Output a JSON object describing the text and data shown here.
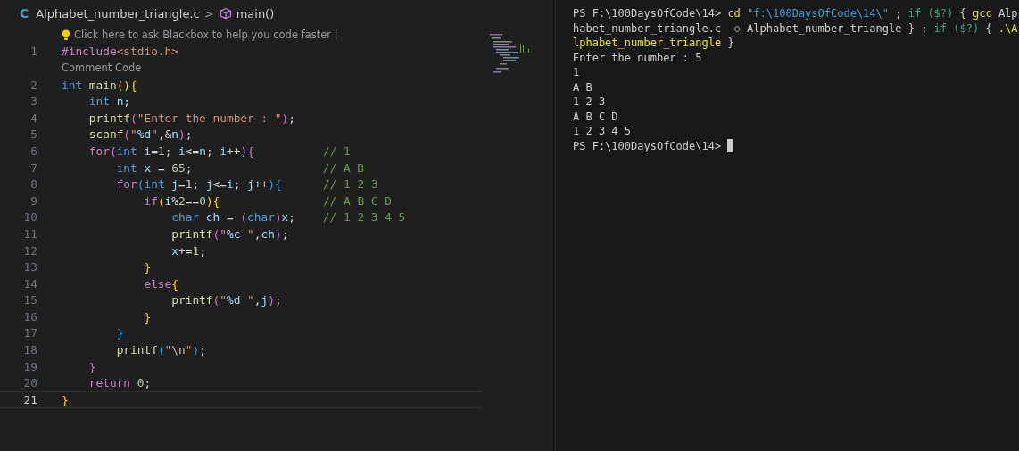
{
  "breadcrumb": {
    "file_icon_letter": "C",
    "file": "Alphabet_number_triangle.c",
    "separator": ">",
    "symbol": "main()"
  },
  "editor": {
    "lines": [
      {
        "kind": "hint",
        "text": "Click here to ask Blackbox to help you code faster |"
      },
      {
        "kind": "code",
        "number": "1",
        "current": false,
        "tokens": [
          {
            "kind": "ctrl",
            "text": "#include"
          },
          {
            "kind": "str",
            "text": "<stdio.h>"
          }
        ]
      },
      {
        "kind": "lens",
        "text": "Comment Code"
      },
      {
        "kind": "code",
        "number": "2",
        "current": false,
        "tokens": [
          {
            "kind": "type",
            "text": "int"
          },
          {
            "kind": "fn",
            "text": " main"
          },
          {
            "kind": "b1",
            "text": "(){"
          }
        ]
      },
      {
        "kind": "code",
        "number": "3",
        "current": false,
        "tokens": [
          {
            "kind": "type",
            "text": "    int"
          },
          {
            "kind": "var",
            "text": " n"
          },
          {
            "kind": "plain",
            "text": ";"
          }
        ]
      },
      {
        "kind": "code",
        "number": "4",
        "current": false,
        "tokens": [
          {
            "kind": "fn",
            "text": "    printf"
          },
          {
            "kind": "b2",
            "text": "("
          },
          {
            "kind": "str",
            "text": "\"Enter the number : \""
          },
          {
            "kind": "b2",
            "text": ")"
          },
          {
            "kind": "plain",
            "text": ";"
          }
        ]
      },
      {
        "kind": "code",
        "number": "5",
        "current": false,
        "tokens": [
          {
            "kind": "fn",
            "text": "    scanf"
          },
          {
            "kind": "b2",
            "text": "("
          },
          {
            "kind": "str",
            "text": "\""
          },
          {
            "kind": "fmt",
            "text": "%d"
          },
          {
            "kind": "str",
            "text": "\""
          },
          {
            "kind": "plain",
            "text": ",&"
          },
          {
            "kind": "var",
            "text": "n"
          },
          {
            "kind": "b2",
            "text": ")"
          },
          {
            "kind": "plain",
            "text": ";"
          }
        ]
      },
      {
        "kind": "code",
        "number": "6",
        "current": false,
        "tokens": [
          {
            "kind": "ctrl",
            "text": "    for"
          },
          {
            "kind": "b2",
            "text": "("
          },
          {
            "kind": "type",
            "text": "int"
          },
          {
            "kind": "var",
            "text": " i"
          },
          {
            "kind": "plain",
            "text": "="
          },
          {
            "kind": "num",
            "text": "1"
          },
          {
            "kind": "plain",
            "text": ";"
          },
          {
            "kind": "var",
            "text": " i"
          },
          {
            "kind": "plain",
            "text": "<="
          },
          {
            "kind": "var",
            "text": "n"
          },
          {
            "kind": "plain",
            "text": ";"
          },
          {
            "kind": "var",
            "text": " i"
          },
          {
            "kind": "plain",
            "text": "++"
          },
          {
            "kind": "b2",
            "text": "){"
          },
          {
            "kind": "cmt",
            "text": "          // 1"
          }
        ]
      },
      {
        "kind": "code",
        "number": "7",
        "current": false,
        "tokens": [
          {
            "kind": "type",
            "text": "        int"
          },
          {
            "kind": "var",
            "text": " x"
          },
          {
            "kind": "plain",
            "text": " = "
          },
          {
            "kind": "num",
            "text": "65"
          },
          {
            "kind": "plain",
            "text": ";"
          },
          {
            "kind": "cmt",
            "text": "                   // A B"
          }
        ]
      },
      {
        "kind": "code",
        "number": "8",
        "current": false,
        "tokens": [
          {
            "kind": "ctrl",
            "text": "        for"
          },
          {
            "kind": "b3",
            "text": "("
          },
          {
            "kind": "type",
            "text": "int"
          },
          {
            "kind": "var",
            "text": " j"
          },
          {
            "kind": "plain",
            "text": "="
          },
          {
            "kind": "num",
            "text": "1"
          },
          {
            "kind": "plain",
            "text": ";"
          },
          {
            "kind": "var",
            "text": " j"
          },
          {
            "kind": "plain",
            "text": "<="
          },
          {
            "kind": "var",
            "text": "i"
          },
          {
            "kind": "plain",
            "text": ";"
          },
          {
            "kind": "var",
            "text": " j"
          },
          {
            "kind": "plain",
            "text": "++"
          },
          {
            "kind": "b3",
            "text": "){"
          },
          {
            "kind": "cmt",
            "text": "      // 1 2 3"
          }
        ]
      },
      {
        "kind": "code",
        "number": "9",
        "current": false,
        "tokens": [
          {
            "kind": "ctrl",
            "text": "            if"
          },
          {
            "kind": "b1",
            "text": "("
          },
          {
            "kind": "var",
            "text": "i"
          },
          {
            "kind": "plain",
            "text": "%"
          },
          {
            "kind": "num",
            "text": "2"
          },
          {
            "kind": "plain",
            "text": "=="
          },
          {
            "kind": "num",
            "text": "0"
          },
          {
            "kind": "b1",
            "text": "){"
          },
          {
            "kind": "cmt",
            "text": "               // A B C D"
          }
        ]
      },
      {
        "kind": "code",
        "number": "10",
        "current": false,
        "tokens": [
          {
            "kind": "type",
            "text": "                char"
          },
          {
            "kind": "var",
            "text": " ch"
          },
          {
            "kind": "plain",
            "text": " = "
          },
          {
            "kind": "b2",
            "text": "("
          },
          {
            "kind": "type",
            "text": "char"
          },
          {
            "kind": "b2",
            "text": ")"
          },
          {
            "kind": "var",
            "text": "x"
          },
          {
            "kind": "plain",
            "text": ";"
          },
          {
            "kind": "cmt",
            "text": "    // 1 2 3 4 5"
          }
        ]
      },
      {
        "kind": "code",
        "number": "11",
        "current": false,
        "tokens": [
          {
            "kind": "fn",
            "text": "                printf"
          },
          {
            "kind": "b2",
            "text": "("
          },
          {
            "kind": "str",
            "text": "\""
          },
          {
            "kind": "fmt",
            "text": "%c"
          },
          {
            "kind": "str",
            "text": " \""
          },
          {
            "kind": "plain",
            "text": ","
          },
          {
            "kind": "var",
            "text": "ch"
          },
          {
            "kind": "b2",
            "text": ")"
          },
          {
            "kind": "plain",
            "text": ";"
          }
        ]
      },
      {
        "kind": "code",
        "number": "12",
        "current": false,
        "tokens": [
          {
            "kind": "var",
            "text": "                x"
          },
          {
            "kind": "plain",
            "text": "+="
          },
          {
            "kind": "num",
            "text": "1"
          },
          {
            "kind": "plain",
            "text": ";"
          }
        ]
      },
      {
        "kind": "code",
        "number": "13",
        "current": false,
        "tokens": [
          {
            "kind": "b1",
            "text": "            }"
          }
        ]
      },
      {
        "kind": "code",
        "number": "14",
        "current": false,
        "tokens": [
          {
            "kind": "ctrl",
            "text": "            else"
          },
          {
            "kind": "b1",
            "text": "{"
          }
        ]
      },
      {
        "kind": "code",
        "number": "15",
        "current": false,
        "tokens": [
          {
            "kind": "fn",
            "text": "                printf"
          },
          {
            "kind": "b2",
            "text": "("
          },
          {
            "kind": "str",
            "text": "\""
          },
          {
            "kind": "fmt",
            "text": "%d"
          },
          {
            "kind": "str",
            "text": " \""
          },
          {
            "kind": "plain",
            "text": ","
          },
          {
            "kind": "var",
            "text": "j"
          },
          {
            "kind": "b2",
            "text": ")"
          },
          {
            "kind": "plain",
            "text": ";"
          }
        ]
      },
      {
        "kind": "code",
        "number": "16",
        "current": false,
        "tokens": [
          {
            "kind": "b1",
            "text": "            }"
          }
        ]
      },
      {
        "kind": "code",
        "number": "17",
        "current": false,
        "tokens": [
          {
            "kind": "b3",
            "text": "        }"
          }
        ]
      },
      {
        "kind": "code",
        "number": "18",
        "current": false,
        "tokens": [
          {
            "kind": "fn",
            "text": "        printf"
          },
          {
            "kind": "b3",
            "text": "("
          },
          {
            "kind": "str",
            "text": "\""
          },
          {
            "kind": "esc",
            "text": "\\n"
          },
          {
            "kind": "str",
            "text": "\""
          },
          {
            "kind": "b3",
            "text": ")"
          },
          {
            "kind": "plain",
            "text": ";"
          }
        ]
      },
      {
        "kind": "code",
        "number": "19",
        "current": false,
        "tokens": [
          {
            "kind": "b2",
            "text": "    }"
          }
        ]
      },
      {
        "kind": "code",
        "number": "20",
        "current": false,
        "tokens": [
          {
            "kind": "ctrl",
            "text": "    return"
          },
          {
            "kind": "num",
            "text": " 0"
          },
          {
            "kind": "plain",
            "text": ";"
          }
        ]
      },
      {
        "kind": "code",
        "number": "21",
        "current": true,
        "tokens": [
          {
            "kind": "b1",
            "text": "}"
          }
        ]
      }
    ]
  },
  "terminal": {
    "lines": [
      [
        {
          "kind": "plain",
          "text": "PS F:\\100DaysOfCode\\14> "
        },
        {
          "kind": "cmd",
          "text": "cd"
        },
        {
          "kind": "str",
          "text": " \"f:\\100DaysOfCode\\14\\\""
        },
        {
          "kind": "plain",
          "text": " ; "
        },
        {
          "kind": "kw",
          "text": "if ($?)"
        },
        {
          "kind": "plain",
          "text": " { "
        },
        {
          "kind": "cmd",
          "text": "gcc"
        },
        {
          "kind": "plain",
          "text": " Alp"
        }
      ],
      [
        {
          "kind": "plain",
          "text": "habet_number_triangle.c "
        },
        {
          "kind": "flag",
          "text": "-o"
        },
        {
          "kind": "plain",
          "text": " Alphabet_number_triangle } ; "
        },
        {
          "kind": "kw",
          "text": "if ($?)"
        },
        {
          "kind": "plain",
          "text": " { "
        },
        {
          "kind": "cmd",
          "text": ".\\A"
        }
      ],
      [
        {
          "kind": "cmd",
          "text": "lphabet_number_triangle"
        },
        {
          "kind": "plain",
          "text": " }"
        }
      ],
      [
        {
          "kind": "plain",
          "text": "Enter the number : 5"
        }
      ],
      [
        {
          "kind": "plain",
          "text": "1"
        }
      ],
      [
        {
          "kind": "plain",
          "text": "A B"
        }
      ],
      [
        {
          "kind": "plain",
          "text": "1 2 3"
        }
      ],
      [
        {
          "kind": "plain",
          "text": "A B C D"
        }
      ],
      [
        {
          "kind": "plain",
          "text": "1 2 3 4 5"
        }
      ],
      [
        {
          "kind": "plain",
          "text": "PS F:\\100DaysOfCode\\14>"
        }
      ]
    ],
    "cursor": true
  }
}
